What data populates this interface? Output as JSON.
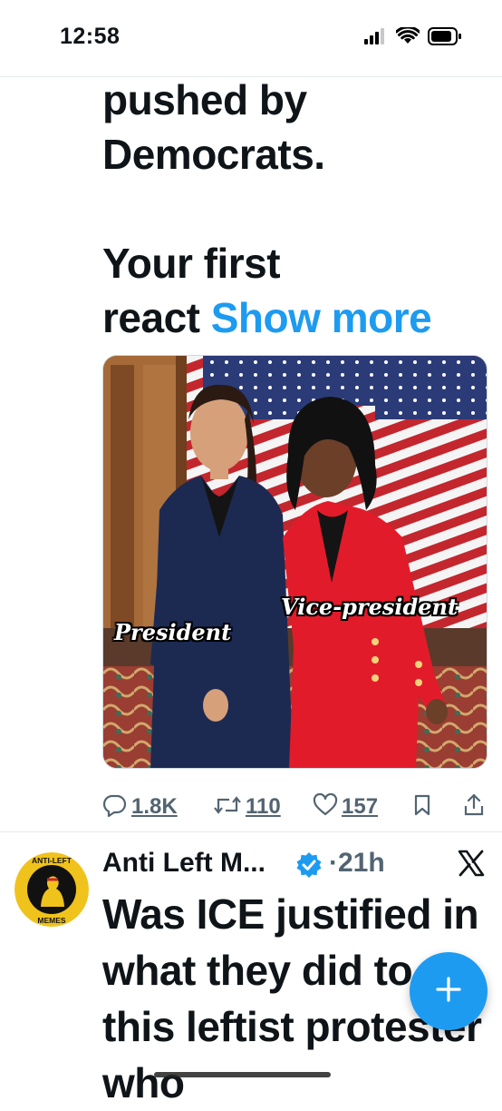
{
  "status_bar": {
    "time": "12:58"
  },
  "tweet1": {
    "text_line1": "pushed by",
    "text_line2": "Democrats.",
    "text_line3": "Your first",
    "text_line4_prefix": "react",
    "show_more": "Show more",
    "media": {
      "label_left": "President",
      "label_right": "Vice-president"
    },
    "actions": {
      "replies": "1.8K",
      "reposts": "110",
      "likes": "157"
    }
  },
  "tweet2": {
    "author_name": "Anti Left M...",
    "separator": "·",
    "timestamp": "21h",
    "avatar_text_top": "ANTI-LEFT",
    "avatar_text_bottom": "MEMES",
    "text": "Was ICE justified in what they did to this leftist protester who"
  },
  "colors": {
    "accent": "#1d9bf0",
    "muted": "#536471",
    "text": "#0f1419"
  }
}
